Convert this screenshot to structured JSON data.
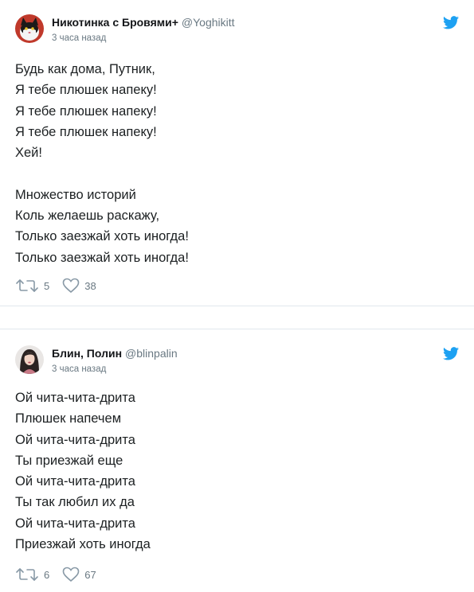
{
  "tweets": [
    {
      "author_name": "Никотинка с Бровями+",
      "handle": "@Yoghikitt",
      "timestamp": "3 часа назад",
      "lines": [
        "Будь как дома, Путник,",
        "Я тебе плюшек напеку!",
        "Я тебе плюшек напеку!",
        "Я тебе плюшек напеку!",
        "Хей!",
        "",
        "Множество историй",
        "Коль желаешь раскажу,",
        "Только заезжай хоть иногда!",
        "Только заезжай хоть иногда!"
      ],
      "retweets": "5",
      "likes": "38"
    },
    {
      "author_name": "Блин, Полин",
      "handle": "@blinpalin",
      "timestamp": "3 часа назад",
      "lines": [
        "Ой чита-чита-дрита",
        "Плюшек напечем",
        "Ой чита-чита-дрита",
        "Ты приезжай еще",
        "Ой чита-чита-дрита",
        "Ты так любил их да",
        "Ой чита-чита-дрита",
        "Приезжай хоть иногда"
      ],
      "retweets": "6",
      "likes": "67"
    }
  ],
  "colors": {
    "twitter_blue": "#1da1f2",
    "secondary_text": "#697882",
    "divider": "#e1e8ed"
  },
  "icons": [
    "avatar-cat",
    "avatar-woman",
    "twitter-bird-icon",
    "retweet-icon",
    "heart-icon"
  ]
}
